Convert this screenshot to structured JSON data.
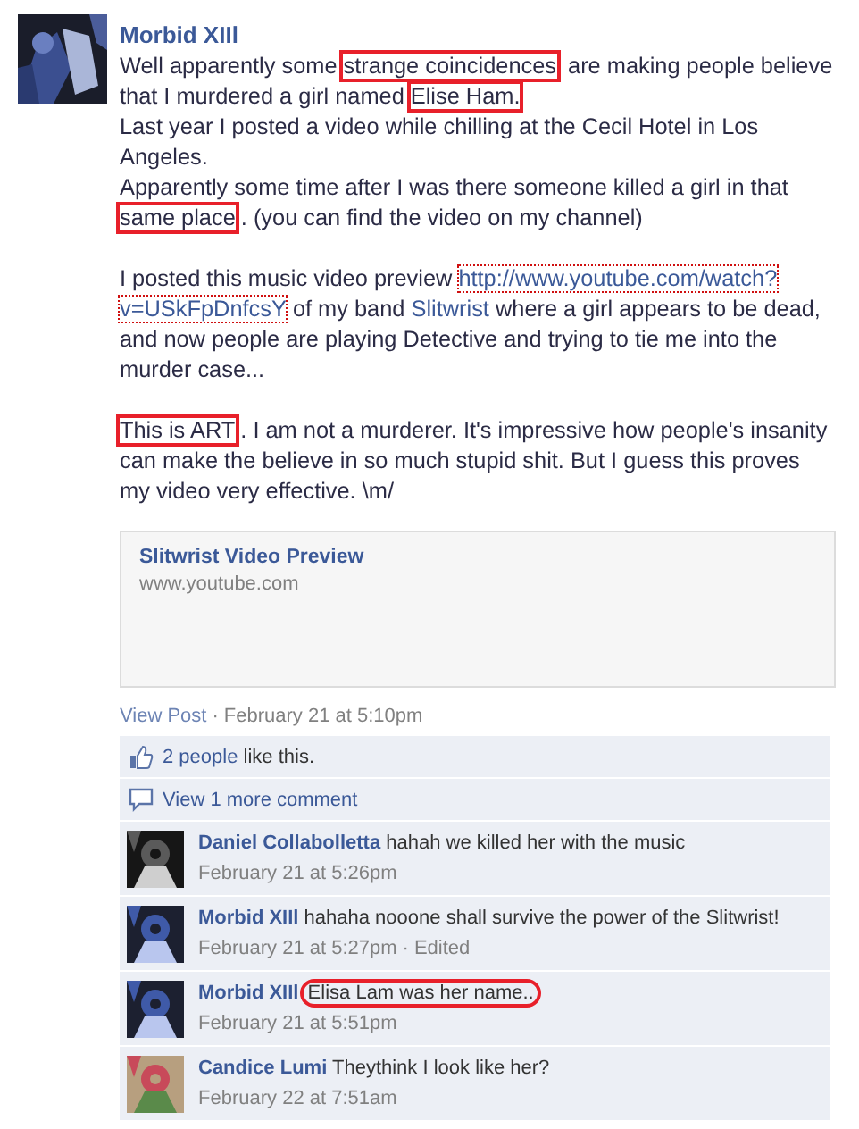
{
  "post": {
    "author": "Morbid XIIl",
    "paragraphs": [
      {
        "segments": [
          {
            "kind": "text",
            "text": "Well apparently some "
          },
          {
            "kind": "circled",
            "text": "strange coincidences"
          },
          {
            "kind": "text",
            "text": " are making people believe that I murdered a girl named "
          },
          {
            "kind": "circled",
            "text": "Elise Ham. "
          },
          {
            "kind": "text",
            "text": "\nLast year I posted a video while chilling at the Cecil Hotel in Los Angeles.\nApparently some time after I was there someone killed a girl in that "
          },
          {
            "kind": "circled",
            "text": "same place"
          },
          {
            "kind": "text",
            "text": ". (you can find the video on my channel)"
          }
        ]
      },
      {
        "segments": [
          {
            "kind": "text",
            "text": "I posted this music video preview "
          },
          {
            "kind": "dotted-link",
            "text": "http://www.youtube.com/watch?"
          },
          {
            "kind": "dotted-link",
            "text": "v=USkFpDnfcsY"
          },
          {
            "kind": "text",
            "text": " of my band "
          },
          {
            "kind": "link",
            "text": "Slitwrist"
          },
          {
            "kind": "text",
            "text": " where a girl appears to be dead, and now people are playing Detective and trying to tie me into the murder case..."
          }
        ]
      },
      {
        "segments": [
          {
            "kind": "circled",
            "text": "This is ART"
          },
          {
            "kind": "text",
            "text": ". I am not a murderer. It's impressive how people's insanity can make the believe in so much stupid shit. But I guess this proves my video very effective. \\m/"
          }
        ]
      }
    ],
    "preview": {
      "title": "Slitwrist Video Preview",
      "domain": "www.youtube.com"
    },
    "view_post": "View Post",
    "separator": "·",
    "timestamp": "February 21 at 5:10pm"
  },
  "likes": {
    "count_link": "2 people",
    "text": " like this."
  },
  "more_comments": "View 1 more comment",
  "comments": [
    {
      "author": "Daniel Collabolletta",
      "segments": [
        {
          "kind": "text",
          "text": "hahah we killed her with the music"
        }
      ],
      "time": "February 21 at 5:26pm"
    },
    {
      "author": "Morbid XIIl",
      "segments": [
        {
          "kind": "text",
          "text": "hahaha nooone shall survive the power of the Slitwrist!"
        }
      ],
      "time": "February 21 at 5:27pm",
      "separator": "·",
      "edited": "Edited"
    },
    {
      "author": "Morbid XIIl",
      "segments": [
        {
          "kind": "circled-round",
          "text": "Elisa Lam was her name.."
        }
      ],
      "time": "February 21 at 5:51pm"
    },
    {
      "author": "Candice Lumi",
      "segments": [
        {
          "kind": "text",
          "text": "Theythink I look like her?"
        }
      ],
      "time": "February 22 at 7:51am"
    }
  ]
}
